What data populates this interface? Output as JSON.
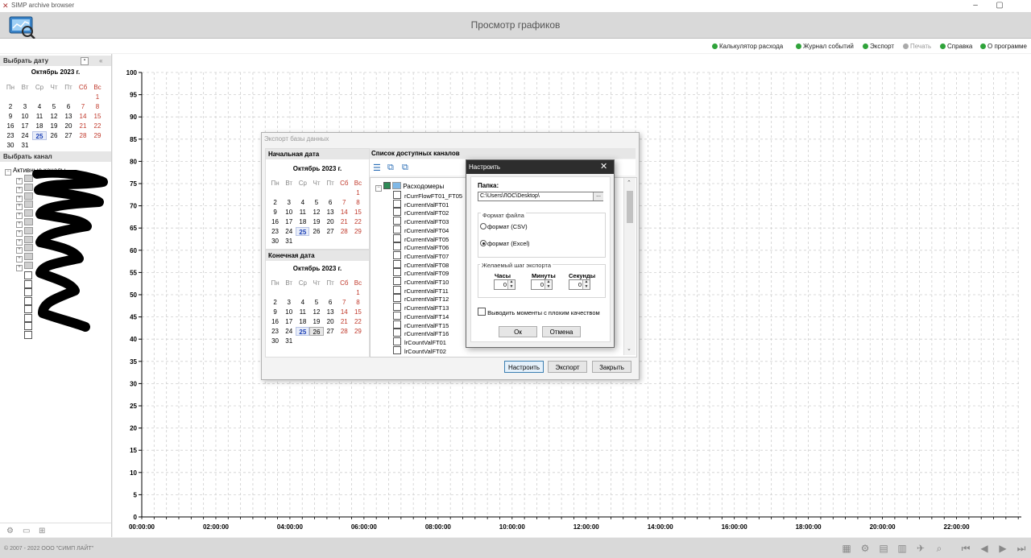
{
  "window": {
    "app_title": "SIMP archive browser",
    "minimize_icon": "minimize-icon",
    "maximize_icon": "maximize-icon"
  },
  "header": {
    "page_title": "Просмотр графиков"
  },
  "menu": {
    "items": [
      {
        "label": "Калькулятор расхода",
        "enabled": true
      },
      {
        "label": "Журнал событий",
        "enabled": true
      },
      {
        "label": "Экспорт",
        "enabled": true
      },
      {
        "label": "Печать",
        "enabled": false
      },
      {
        "label": "Справка",
        "enabled": true
      },
      {
        "label": "О программе",
        "enabled": true
      }
    ],
    "accent_color": "#2fa33a"
  },
  "left_panel": {
    "date_section_title": "Выбрать дату",
    "calendar": {
      "month_label": "Октябрь  2023 г.",
      "weekdays": [
        "Пн",
        "Вт",
        "Ср",
        "Чт",
        "Пт",
        "Сб",
        "Вс"
      ],
      "first_weekday_offset": 6,
      "days_in_month": 31,
      "today": 25
    },
    "channel_section_title": "Выбрать канал",
    "tree_root_label": "Активные каналы"
  },
  "chart_data": {
    "type": "line",
    "y_ticks": [
      "100",
      "95",
      "90",
      "85",
      "80",
      "75",
      "70",
      "65",
      "60",
      "55",
      "50",
      "45",
      "40",
      "35",
      "30",
      "25",
      "20",
      "15",
      "10",
      "5",
      "0"
    ],
    "x_ticks": [
      "00:00:00",
      "02:00:00",
      "04:00:00",
      "06:00:00",
      "08:00:00",
      "10:00:00",
      "12:00:00",
      "14:00:00",
      "16:00:00",
      "18:00:00",
      "20:00:00",
      "22:00:00"
    ],
    "ylim": [
      0,
      100
    ],
    "grid": true,
    "series": []
  },
  "export_dialog": {
    "title": "Экспорт базы данных",
    "start_date_title": "Начальная дата",
    "end_date_title": "Конечная дата",
    "start_calendar": {
      "month_label": "Октябрь  2023 г.",
      "today": 25,
      "selected": null
    },
    "end_calendar": {
      "month_label": "Октябрь  2023 г.",
      "today": 25,
      "selected": 26
    },
    "channels_title": "Список доступных каналов",
    "group_label": "Расходомеры",
    "channels": [
      "rCurrFlowFT01_FT05",
      "rCurrentValFT01",
      "rCurrentValFT02",
      "rCurrentValFT03",
      "rCurrentValFT04",
      "rCurrentValFT05",
      "rCurrentValFT06",
      "rCurrentValFT07",
      "rCurrentValFT08",
      "rCurrentValFT09",
      "rCurrentValFT10",
      "rCurrentValFT11",
      "rCurrentValFT12",
      "rCurrentValFT13",
      "rCurrentValFT14",
      "rCurrentValFT15",
      "rCurrentValFT16",
      "lrCountValFT01",
      "lrCountValFT02"
    ],
    "buttons": {
      "configure": "Настроить",
      "export": "Экспорт",
      "close": "Закрыть"
    }
  },
  "settings_dialog": {
    "title": "Настроить",
    "folder_label": "Папка:",
    "folder_value": "C:\\Users\\ЛОС\\Desktop\\",
    "browse_label": "...",
    "file_format_title": "Формат файла",
    "format_csv": "формат (CSV)",
    "format_excel": "формат (Excel)",
    "selected_format": "excel",
    "step_title": "Желаемый шаг экспорта",
    "hours_label": "Часы",
    "minutes_label": "Минуты",
    "seconds_label": "Секунды",
    "hours_value": "0",
    "minutes_value": "0",
    "seconds_value": "0",
    "bad_quality_label": "Выводить моменты с плохим качеством",
    "ok_label": "Ок",
    "cancel_label": "Отмена"
  },
  "status_bar": {
    "copyright": "© 2007 - 2022  ООО \"СИМП ЛАЙТ\""
  }
}
